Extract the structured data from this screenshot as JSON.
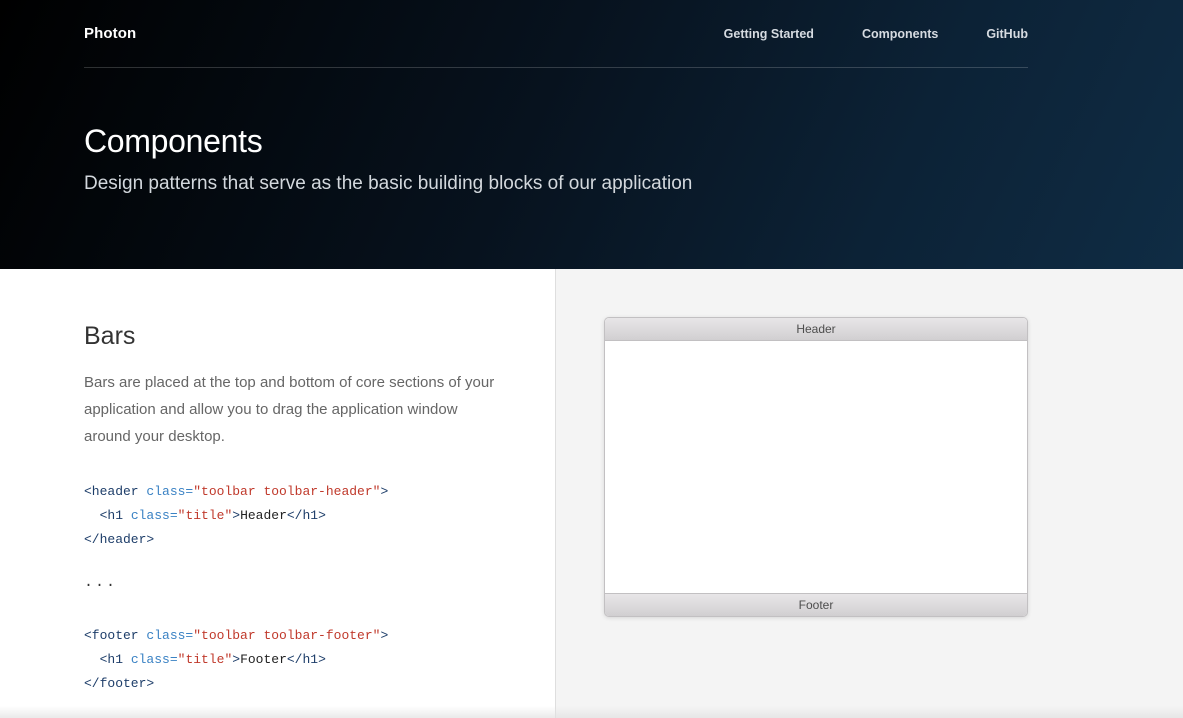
{
  "nav": {
    "brand": "Photon",
    "links": [
      "Getting Started",
      "Components",
      "GitHub"
    ]
  },
  "hero": {
    "title": "Components",
    "subtitle": "Design patterns that serve as the basic building blocks of our application"
  },
  "section": {
    "title": "Bars",
    "description": "Bars are placed at the top and bottom of core sections of your application and allow you to drag the application window around your desktop.",
    "code_header": {
      "open_tag": "<header",
      "attr": "class=",
      "value": "\"toolbar toolbar-header\"",
      "close_bracket": ">",
      "h1_open": "<h1",
      "h1_attr": "class=",
      "h1_value": "\"title\"",
      "h1_text": "Header",
      "h1_close": "</h1>",
      "close_tag": "</header>"
    },
    "ellipsis": "...",
    "code_footer": {
      "open_tag": "<footer",
      "attr": "class=",
      "value": "\"toolbar toolbar-footer\"",
      "close_bracket": ">",
      "h1_open": "<h1",
      "h1_attr": "class=",
      "h1_value": "\"title\"",
      "h1_text": "Footer",
      "h1_close": "</h1>",
      "close_tag": "</footer>"
    }
  },
  "demo": {
    "header_label": "Header",
    "footer_label": "Footer"
  },
  "colors": {
    "code_tag": "#1d3d69",
    "code_attr": "#3a82c4",
    "code_string": "#c0392b"
  }
}
